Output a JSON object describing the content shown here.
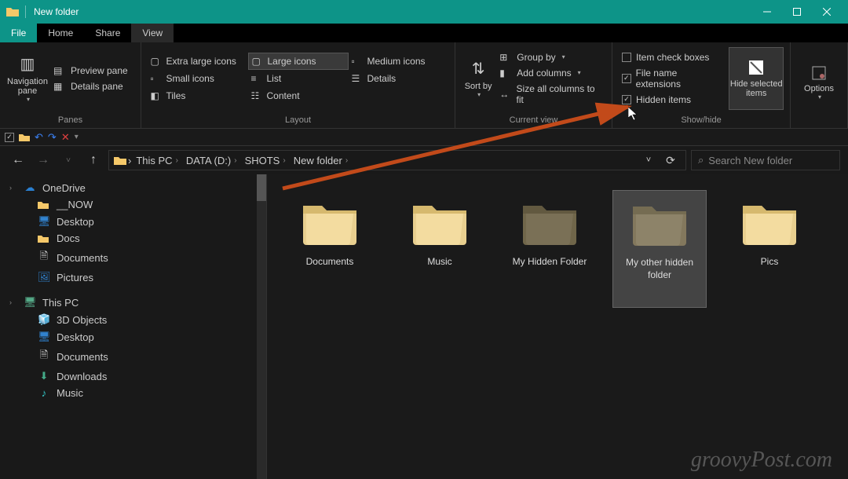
{
  "window": {
    "title": "New folder"
  },
  "tabs": {
    "file": "File",
    "home": "Home",
    "share": "Share",
    "view": "View"
  },
  "ribbon": {
    "panes": {
      "nav": "Navigation pane",
      "preview": "Preview pane",
      "details": "Details pane",
      "group": "Panes"
    },
    "layout": {
      "xl": "Extra large icons",
      "lg": "Large icons",
      "md": "Medium icons",
      "sm": "Small icons",
      "list": "List",
      "details": "Details",
      "tiles": "Tiles",
      "content": "Content",
      "group": "Layout"
    },
    "current": {
      "sort": "Sort by",
      "groupby": "Group by",
      "addcols": "Add columns",
      "sizeall": "Size all columns to fit",
      "group": "Current view"
    },
    "showhide": {
      "checkboxes": "Item check boxes",
      "ext": "File name extensions",
      "hidden": "Hidden items",
      "hidesel": "Hide selected items",
      "group": "Show/hide"
    },
    "options": "Options"
  },
  "breadcrumb": [
    "This PC",
    "DATA (D:)",
    "SHOTS",
    "New folder"
  ],
  "search": {
    "placeholder": "Search New folder"
  },
  "sidebar": {
    "onedrive": "OneDrive",
    "now": "__NOW",
    "desktop": "Desktop",
    "docs": "Docs",
    "documents": "Documents",
    "pictures": "Pictures",
    "thispc": "This PC",
    "objects3d": "3D Objects",
    "desktop2": "Desktop",
    "documents2": "Documents",
    "downloads": "Downloads",
    "music": "Music"
  },
  "folders": [
    {
      "name": "Documents",
      "hidden": false,
      "selected": false
    },
    {
      "name": "Music",
      "hidden": false,
      "selected": false
    },
    {
      "name": "My Hidden Folder",
      "hidden": true,
      "selected": false
    },
    {
      "name": "My other hidden folder",
      "hidden": true,
      "selected": true
    },
    {
      "name": "Pics",
      "hidden": false,
      "selected": false
    }
  ],
  "watermark": "groovyPost.com"
}
